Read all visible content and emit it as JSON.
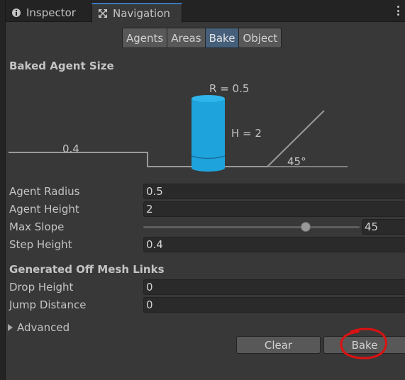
{
  "tabs": [
    {
      "label": "Inspector",
      "icon": "info-icon",
      "active": false
    },
    {
      "label": "Navigation",
      "icon": "navigation-icon",
      "active": true
    }
  ],
  "segments": [
    {
      "label": "Agents",
      "active": false
    },
    {
      "label": "Areas",
      "active": false
    },
    {
      "label": "Bake",
      "active": true
    },
    {
      "label": "Object",
      "active": false
    }
  ],
  "baked_agent_size": {
    "title": "Baked Agent Size",
    "diagram": {
      "radius_label": "R = 0.5",
      "height_label": "H = 2",
      "step_label": "0.4",
      "slope_label": "45°",
      "cylinder_color": "#1fa3dd"
    },
    "fields": [
      {
        "label": "Agent Radius",
        "value": "0.5"
      },
      {
        "label": "Agent Height",
        "value": "2"
      },
      {
        "label": "Max Slope",
        "value": "45",
        "slider_fraction": 0.75
      },
      {
        "label": "Step Height",
        "value": "0.4"
      }
    ]
  },
  "off_mesh_links": {
    "title": "Generated Off Mesh Links",
    "fields": [
      {
        "label": "Drop Height",
        "value": "0"
      },
      {
        "label": "Jump Distance",
        "value": "0"
      }
    ]
  },
  "advanced": {
    "label": "Advanced",
    "expanded": false
  },
  "buttons": {
    "clear": "Clear",
    "bake": "Bake"
  },
  "colors": {
    "accent": "#3a79bb",
    "active_segment": "#46607c",
    "annotation": "#dd1111"
  }
}
